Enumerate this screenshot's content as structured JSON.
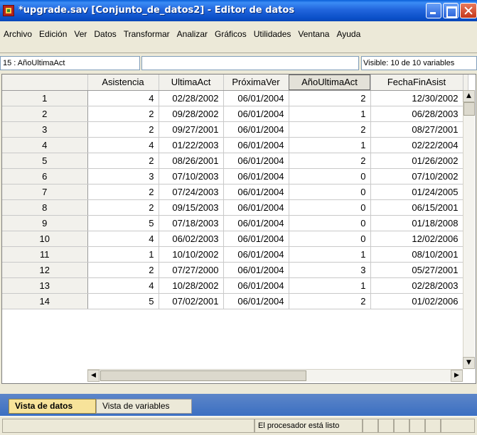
{
  "window": {
    "title": "*upgrade.sav [Conjunto_de_datos2] - Editor de datos"
  },
  "menu": {
    "items": [
      "Archivo",
      "Edición",
      "Ver",
      "Datos",
      "Transformar",
      "Analizar",
      "Gráficos",
      "Utilidades",
      "Ventana",
      "Ayuda"
    ]
  },
  "cell_editor": {
    "reference": "15 : AñoUltimaAct",
    "value": "",
    "visible_info": "Visible: 10 de 10 variables"
  },
  "grid": {
    "columns": [
      "Asistencia",
      "UltimaAct",
      "PróximaVer",
      "AñoUltimaAct",
      "FechaFinAsist"
    ],
    "selected_column": "AñoUltimaAct",
    "rows": [
      {
        "num": "1",
        "cells": [
          "4",
          "02/28/2002",
          "06/01/2004",
          "2",
          "12/30/2002"
        ]
      },
      {
        "num": "2",
        "cells": [
          "2",
          "09/28/2002",
          "06/01/2004",
          "1",
          "06/28/2003"
        ]
      },
      {
        "num": "3",
        "cells": [
          "2",
          "09/27/2001",
          "06/01/2004",
          "2",
          "08/27/2001"
        ]
      },
      {
        "num": "4",
        "cells": [
          "4",
          "01/22/2003",
          "06/01/2004",
          "1",
          "02/22/2004"
        ]
      },
      {
        "num": "5",
        "cells": [
          "2",
          "08/26/2001",
          "06/01/2004",
          "2",
          "01/26/2002"
        ]
      },
      {
        "num": "6",
        "cells": [
          "3",
          "07/10/2003",
          "06/01/2004",
          "0",
          "07/10/2002"
        ]
      },
      {
        "num": "7",
        "cells": [
          "2",
          "07/24/2003",
          "06/01/2004",
          "0",
          "01/24/2005"
        ]
      },
      {
        "num": "8",
        "cells": [
          "2",
          "09/15/2003",
          "06/01/2004",
          "0",
          "06/15/2001"
        ]
      },
      {
        "num": "9",
        "cells": [
          "5",
          "07/18/2003",
          "06/01/2004",
          "0",
          "01/18/2008"
        ]
      },
      {
        "num": "10",
        "cells": [
          "4",
          "06/02/2003",
          "06/01/2004",
          "0",
          "12/02/2006"
        ]
      },
      {
        "num": "11",
        "cells": [
          "1",
          "10/10/2002",
          "06/01/2004",
          "1",
          "08/10/2001"
        ]
      },
      {
        "num": "12",
        "cells": [
          "2",
          "07/27/2000",
          "06/01/2004",
          "3",
          "05/27/2001"
        ]
      },
      {
        "num": "13",
        "cells": [
          "4",
          "10/28/2002",
          "06/01/2004",
          "1",
          "02/28/2003"
        ]
      },
      {
        "num": "14",
        "cells": [
          "5",
          "07/02/2001",
          "06/01/2004",
          "2",
          "01/02/2006"
        ]
      }
    ]
  },
  "tabs": {
    "data_view": "Vista de datos",
    "variable_view": "Vista de variables"
  },
  "status": {
    "processor": "El procesador está listo"
  },
  "colors": {
    "title_bar": "#2266dd",
    "active_tab": "#f7e39a",
    "tab_strip": "#3b6fc1"
  }
}
